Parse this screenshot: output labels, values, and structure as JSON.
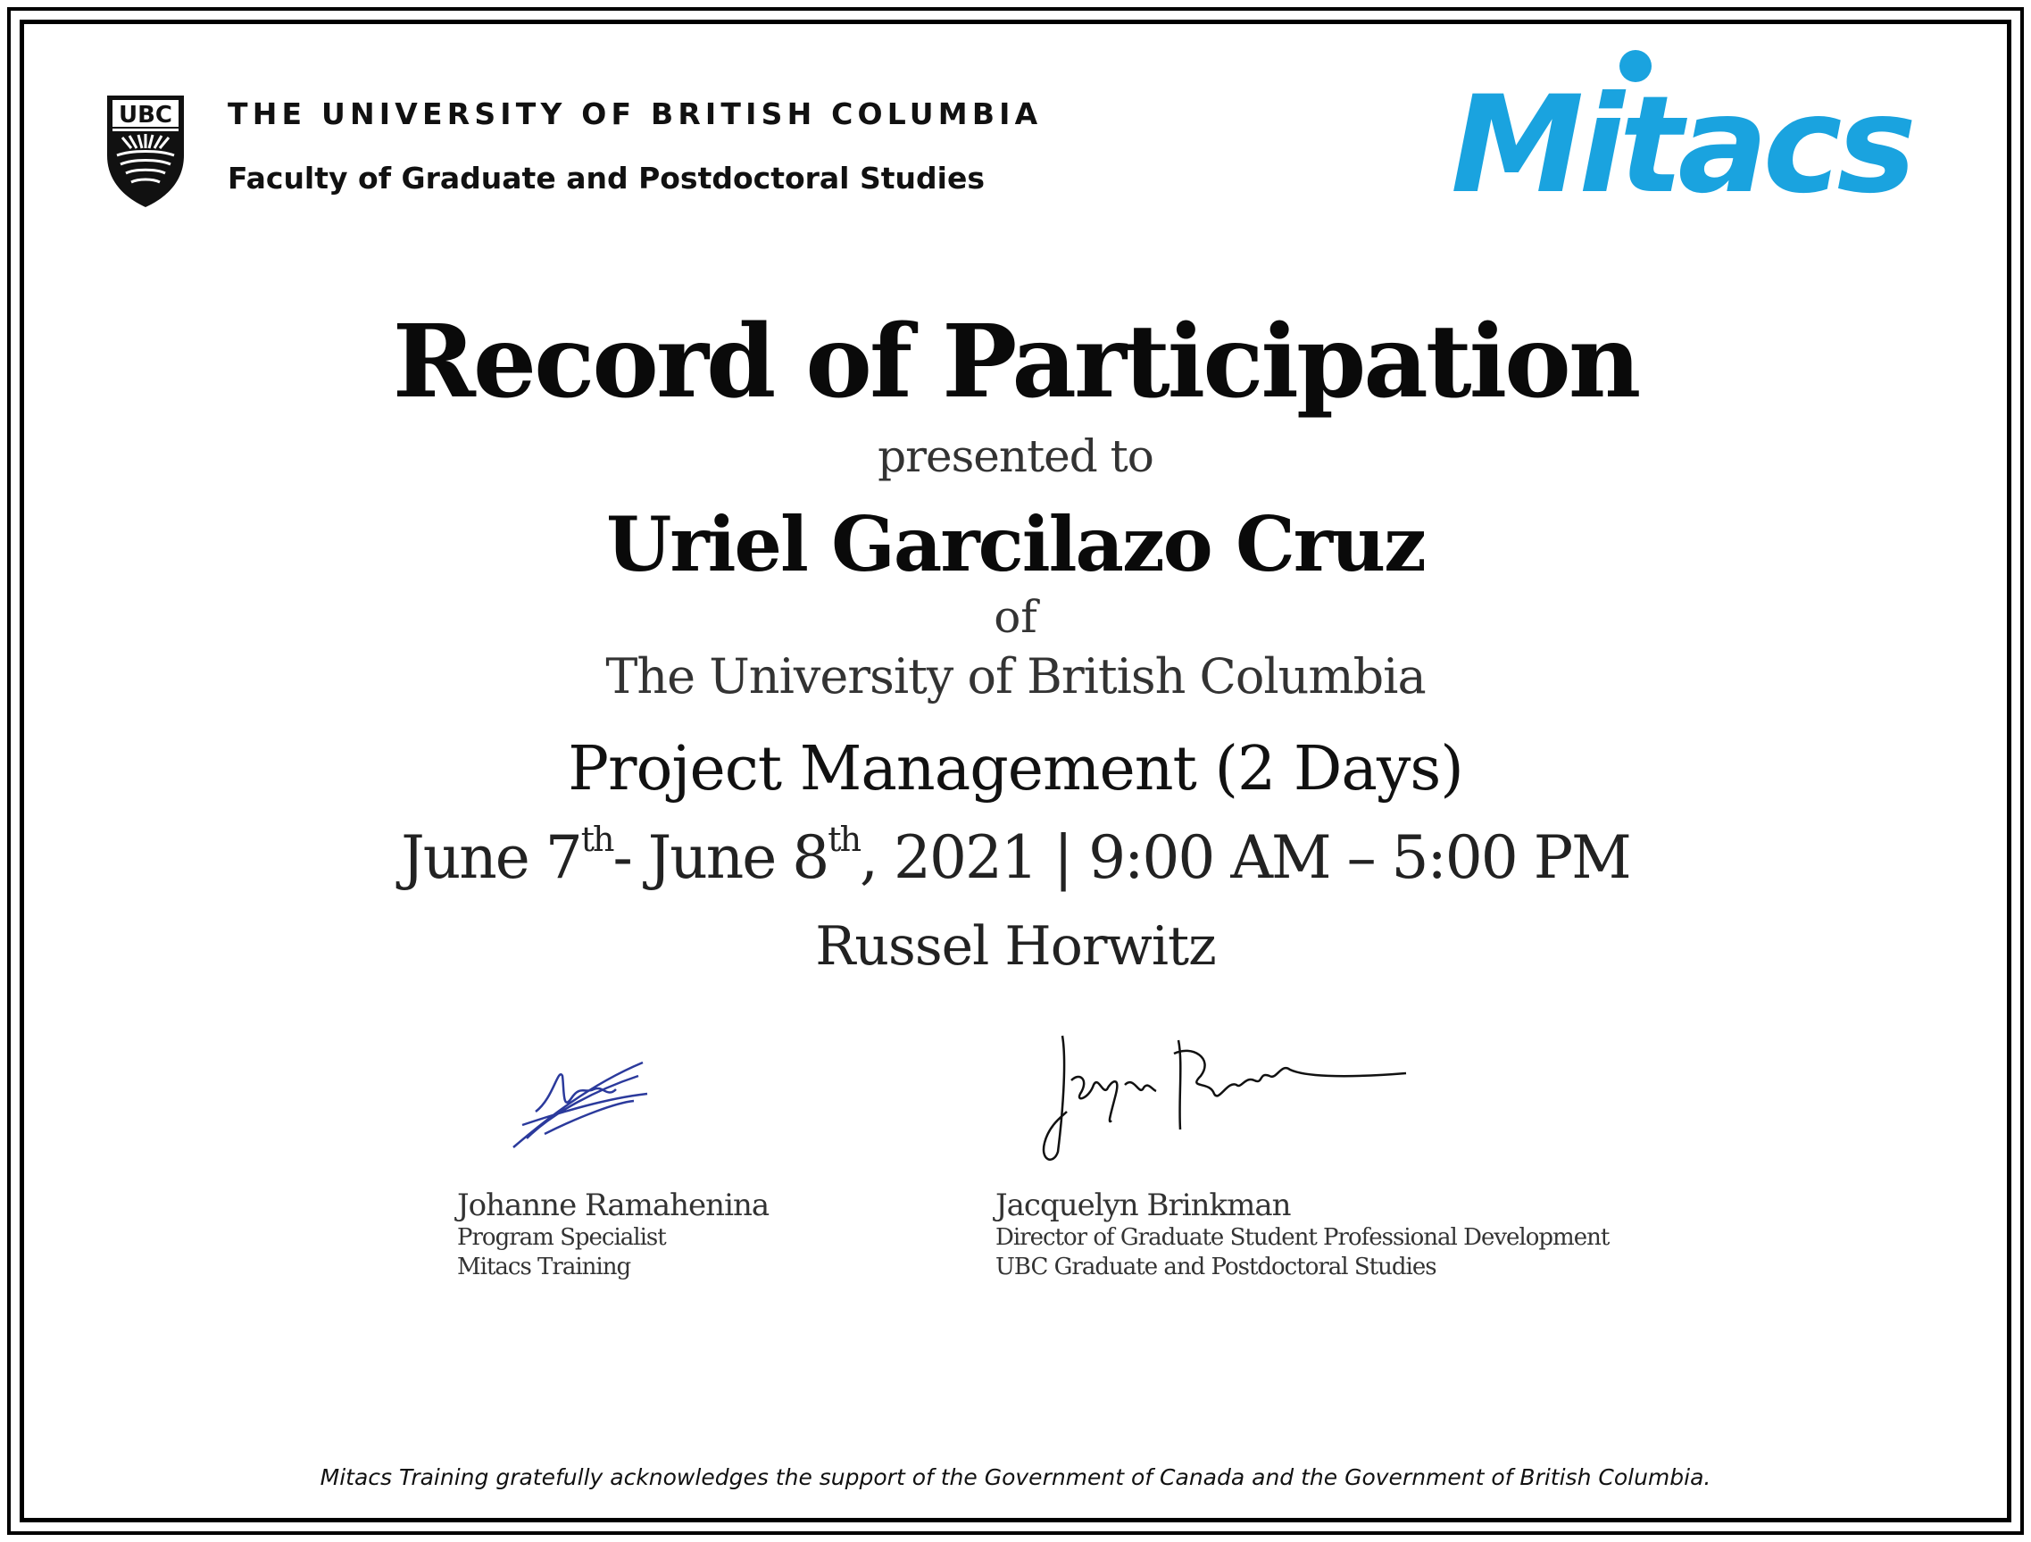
{
  "ubc": {
    "logo_text": "UBC",
    "title": "THE UNIVERSITY OF BRITISH COLUMBIA",
    "subtitle": "Faculty of Graduate and Postdoctoral Studies"
  },
  "mitacs": {
    "logo_text": "Mitacs",
    "color": "#1aa3df"
  },
  "certificate": {
    "title": "Record of Participation",
    "presented_to": "presented to",
    "recipient": "Uriel Garcilazo Cruz",
    "of": "of",
    "institution": "The University of British Columbia",
    "course": "Project Management (2 Days)",
    "date": {
      "start": "June 7",
      "start_suffix": "th",
      "middle": "- June 8",
      "end_suffix": "th",
      "rest": ", 2021 | 9:00 AM – 5:00 PM"
    },
    "instructor": "Russel Horwitz"
  },
  "signatories": [
    {
      "name": "Johanne Ramahenina",
      "title": "Program Specialist",
      "org": "Mitacs Training"
    },
    {
      "name": "Jacquelyn Brinkman",
      "title": "Director of Graduate Student Professional Development",
      "org": "UBC Graduate and Postdoctoral Studies"
    }
  ],
  "footer": "Mitacs Training gratefully acknowledges the support of the Government of Canada and the Government of British Columbia."
}
